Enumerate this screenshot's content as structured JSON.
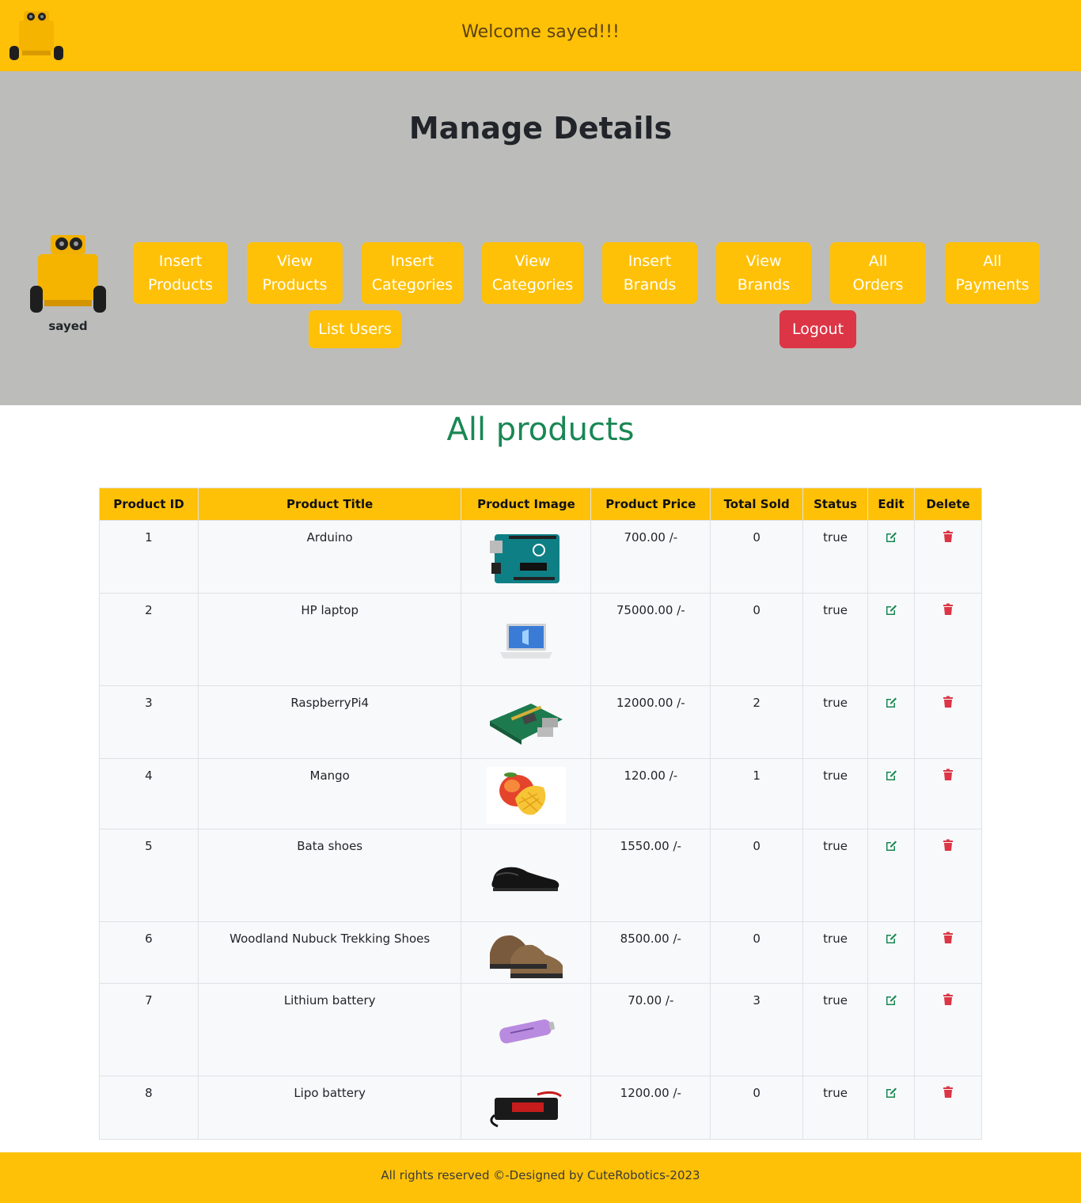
{
  "topbar": {
    "welcome": "Welcome sayed!!!",
    "logo_icon": "robot-logo-icon"
  },
  "hero": {
    "title": "Manage Details",
    "username": "sayed",
    "avatar_icon": "robot-avatar-icon",
    "nav": [
      {
        "line1": "Insert",
        "line2": "Products"
      },
      {
        "line1": "View",
        "line2": "Products"
      },
      {
        "line1": "Insert",
        "line2": "Categories"
      },
      {
        "line1": "View",
        "line2": "Categories"
      },
      {
        "line1": "Insert",
        "line2": "Brands"
      },
      {
        "line1": "View",
        "line2": "Brands"
      },
      {
        "line1": "All",
        "line2": "Orders"
      },
      {
        "line1": "All",
        "line2": "Payments"
      }
    ],
    "list_users": "List Users",
    "logout": "Logout"
  },
  "colors": {
    "accent": "#ffc107",
    "hero_bg": "#bcbcbb",
    "success": "#198754",
    "danger": "#dc3545"
  },
  "main": {
    "title": "All products",
    "columns": [
      "Product ID",
      "Product Title",
      "Product Image",
      "Product Price",
      "Total Sold",
      "Status",
      "Edit",
      "Delete"
    ],
    "rows": [
      {
        "id": "1",
        "title": "Arduino",
        "image": "arduino-board-image",
        "price": "700.00 /-",
        "sold": "0",
        "status": "true"
      },
      {
        "id": "2",
        "title": "HP laptop",
        "image": "laptop-image",
        "price": "75000.00 /-",
        "sold": "0",
        "status": "true"
      },
      {
        "id": "3",
        "title": "RaspberryPi4",
        "image": "raspberry-pi-image",
        "price": "12000.00 /-",
        "sold": "2",
        "status": "true"
      },
      {
        "id": "4",
        "title": "Mango",
        "image": "mango-image",
        "price": "120.00 /-",
        "sold": "1",
        "status": "true"
      },
      {
        "id": "5",
        "title": "Bata shoes",
        "image": "black-shoe-image",
        "price": "1550.00 /-",
        "sold": "0",
        "status": "true"
      },
      {
        "id": "6",
        "title": "Woodland Nubuck Trekking Shoes",
        "image": "trekking-shoes-image",
        "price": "8500.00 /-",
        "sold": "0",
        "status": "true"
      },
      {
        "id": "7",
        "title": "Lithium battery",
        "image": "lithium-battery-image",
        "price": "70.00 /-",
        "sold": "3",
        "status": "true"
      },
      {
        "id": "8",
        "title": "Lipo battery",
        "image": "lipo-battery-image",
        "price": "1200.00 /-",
        "sold": "0",
        "status": "true"
      }
    ],
    "edit_icon": "edit-icon",
    "delete_icon": "trash-icon"
  },
  "footer": {
    "text": "All rights reserved ©-Designed by CuteRobotics-2023"
  }
}
